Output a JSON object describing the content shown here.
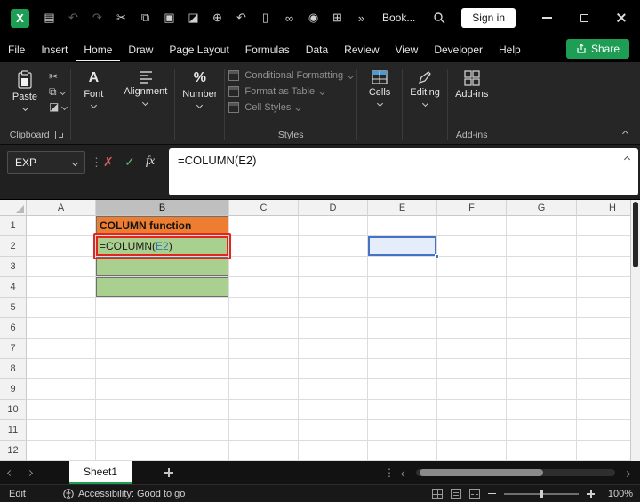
{
  "window": {
    "logo_text": "X",
    "title": "Book...",
    "sign_in_label": "Sign in"
  },
  "titlebar": {
    "quick_access": [
      {
        "name": "save-icon",
        "glyph": "▤"
      },
      {
        "name": "undo-icon",
        "glyph": "↶",
        "disabled": true
      },
      {
        "name": "redo-icon",
        "glyph": "↷",
        "disabled": true
      },
      {
        "name": "cut-icon",
        "glyph": "✂"
      },
      {
        "name": "copy-icon",
        "glyph": "⧉"
      },
      {
        "name": "paste-icon",
        "glyph": "▣"
      },
      {
        "name": "format-painter-icon",
        "glyph": "◪"
      },
      {
        "name": "spelling-icon",
        "glyph": "⊕"
      },
      {
        "name": "undo-history-icon",
        "glyph": "↶"
      },
      {
        "name": "document-icon",
        "glyph": "▯"
      },
      {
        "name": "link-icon",
        "glyph": "∞"
      },
      {
        "name": "camera-icon",
        "glyph": "◉"
      },
      {
        "name": "table-icon",
        "glyph": "⊞"
      },
      {
        "name": "more-commands-icon",
        "glyph": "»"
      }
    ]
  },
  "menubar": {
    "items": [
      {
        "label": "File"
      },
      {
        "label": "Insert"
      },
      {
        "label": "Home",
        "active": true
      },
      {
        "label": "Draw"
      },
      {
        "label": "Page Layout"
      },
      {
        "label": "Formulas"
      },
      {
        "label": "Data"
      },
      {
        "label": "Review"
      },
      {
        "label": "View"
      },
      {
        "label": "Developer"
      },
      {
        "label": "Help"
      }
    ],
    "share_label": "Share"
  },
  "ribbon": {
    "paste_label": "Paste",
    "clipboard_group_label": "Clipboard",
    "font_label": "Font",
    "alignment_label": "Alignment",
    "number_label": "Number",
    "styles_items": [
      {
        "label": "Conditional Formatting"
      },
      {
        "label": "Format as Table"
      },
      {
        "label": "Cell Styles"
      }
    ],
    "styles_group_label": "Styles",
    "cells_label": "Cells",
    "editing_label": "Editing",
    "addins_label": "Add-ins",
    "addins_group_label": "Add-ins"
  },
  "formula_bar": {
    "name_box": "EXP",
    "formula": "=COLUMN(E2)"
  },
  "grid": {
    "columns": [
      "A",
      "B",
      "C",
      "D",
      "E",
      "F",
      "G",
      "H"
    ],
    "rows": [
      1,
      2,
      3,
      4,
      5,
      6,
      7,
      8,
      9,
      10,
      11,
      12
    ],
    "active_column": "B",
    "cells": {
      "B1": {
        "text": "COLUMN function",
        "bg": "#ED7D31",
        "bold": true,
        "range_border": true
      },
      "B2": {
        "segments": [
          {
            "text": "=COLUMN(",
            "color": "#1a1a1a"
          },
          {
            "text": "E2",
            "color": "#2E75B6"
          },
          {
            "text": ")",
            "color": "#1a1a1a"
          }
        ],
        "bg": "#A9D08E",
        "range_border": true,
        "annotation": true
      },
      "B3": {
        "bg": "#A9D08E",
        "range_border": true
      },
      "B4": {
        "bg": "#A9D08E",
        "range_border": true
      },
      "E2": {
        "selected": true
      }
    }
  },
  "sheet_bar": {
    "tabs": [
      {
        "label": "Sheet1",
        "active": true
      }
    ]
  },
  "status_bar": {
    "mode": "Edit",
    "accessibility_label": "Accessibility: Good to go",
    "zoom_label": "100%"
  },
  "colors": {
    "accent_green": "#1E9E54",
    "header_fill_orange": "#ED7D31",
    "data_fill_green": "#A9D08E",
    "reference_blue": "#2E75B6",
    "selection_blue": "#4472C4",
    "annotation_red": "#E2251F"
  }
}
